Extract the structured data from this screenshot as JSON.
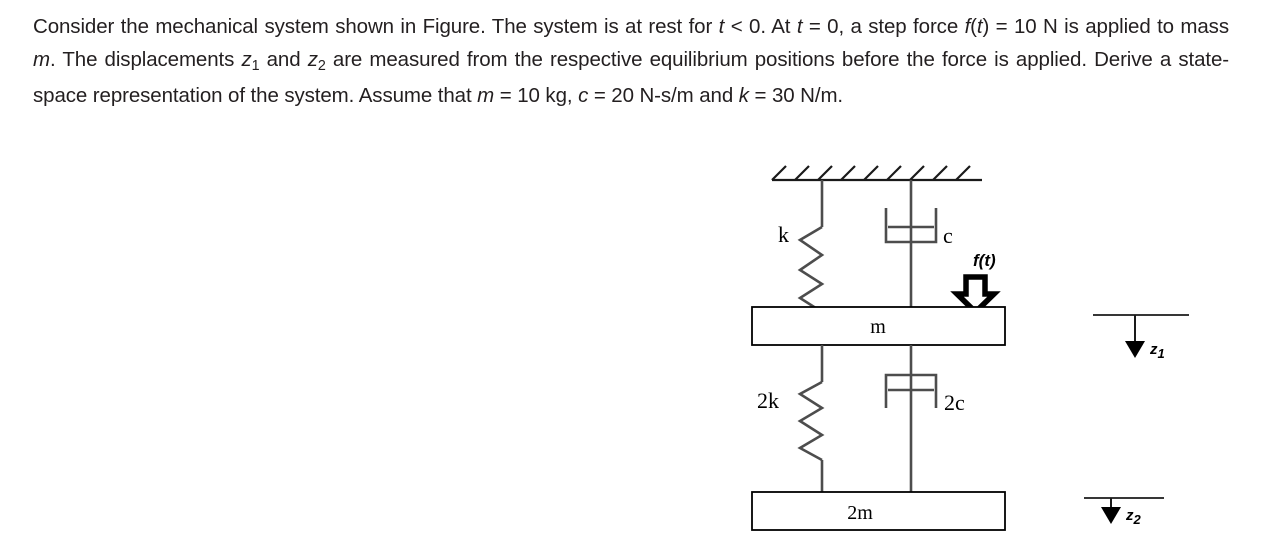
{
  "problem": {
    "segments": [
      {
        "t": "Consider the mechanical system shown in Figure. The system is at rest for "
      },
      {
        "t": "t",
        "style": "italic"
      },
      {
        "t": " < 0. At "
      },
      {
        "t": "t",
        "style": "italic"
      },
      {
        "t": " = 0, a step force "
      },
      {
        "t": "f",
        "style": "italic"
      },
      {
        "t": "("
      },
      {
        "t": "t",
        "style": "italic"
      },
      {
        "t": ") = 10 N is applied to mass "
      },
      {
        "t": "m",
        "style": "italic"
      },
      {
        "t": ". The displacements "
      },
      {
        "t": "z",
        "style": "italic"
      },
      {
        "t": "1",
        "style": "sub"
      },
      {
        "t": " and "
      },
      {
        "t": "z",
        "style": "italic"
      },
      {
        "t": "2",
        "style": "sub"
      },
      {
        "t": " are measured from the respective equilibrium positions before the force is applied. Derive a state-space representation of the system. Assume that "
      },
      {
        "t": "m",
        "style": "italic"
      },
      {
        "t": " = 10 kg, "
      },
      {
        "t": "c",
        "style": "italic"
      },
      {
        "t": " = 20 N-s/m and "
      },
      {
        "t": "k",
        "style": "italic"
      },
      {
        "t": " = 30 N/m."
      }
    ],
    "plain": "Consider the mechanical system shown in Figure. The system is at rest for t < 0. At t = 0, a step force f(t) = 10 N is applied to mass m. The displacements z1 and z2 are measured from the respective equilibrium positions before the force is applied. Derive a state-space representation of the system. Assume that m = 10 kg, c = 20 N-s/m and k = 30 N/m."
  },
  "figure": {
    "labels": {
      "spring_top": "k",
      "damper_top": "c",
      "force": "f(t)",
      "mass_top": "m",
      "spring_bottom": "2k",
      "damper_bottom": "2c",
      "mass_bottom": "2m",
      "disp_top": "z",
      "disp_top_sub": "1",
      "disp_bottom": "z",
      "disp_bottom_sub": "2"
    },
    "colors": {
      "line": "#4d4d4d",
      "outline": "#000000",
      "arrow_fill": "#000000",
      "text": "#000000",
      "background": "#ffffff"
    },
    "hatch_count": 9
  }
}
